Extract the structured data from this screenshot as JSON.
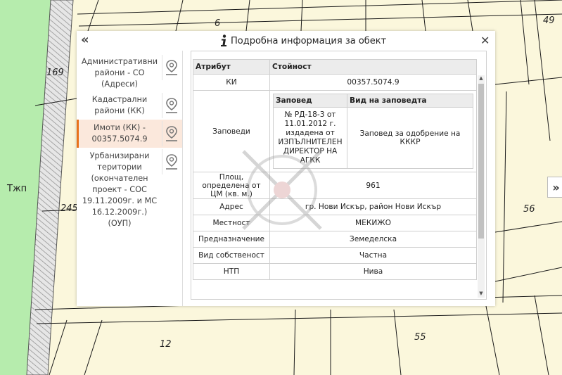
{
  "map": {
    "labels": [
      "6",
      "49",
      "169",
      "Тжп",
      "245",
      "56",
      "12",
      "55"
    ]
  },
  "panel": {
    "collapse_glyph": "«",
    "title": "Подробна информация за обект",
    "close_glyph": "✕",
    "expand_glyph": "»"
  },
  "sidebar": {
    "items": [
      {
        "label": "Административни райони - СО (Адреси)",
        "icon": "map-pin-icon"
      },
      {
        "label": "Кадастрални райони (КК)",
        "icon": "map-pin-icon"
      },
      {
        "label": "Имоти (КК) - 00357.5074.9",
        "icon": "map-pin-icon",
        "active": true
      },
      {
        "label": "Урбанизирани територии (окончателен проект - СОС 19.11.2009г. и МС 16.12.2009г.) (ОУП)",
        "icon": "map-pin-icon"
      }
    ]
  },
  "table": {
    "header_attr": "Атрибут",
    "header_value": "Стойност",
    "rows": [
      {
        "k": "КИ",
        "v": "00357.5074.9"
      },
      {
        "k": "Заповеди",
        "v": ""
      },
      {
        "k": "Площ, определена от ЦМ (кв. м.)",
        "v": "961"
      },
      {
        "k": "Адрес",
        "v": "гр. Нови Искър, район Нови Искър"
      },
      {
        "k": "Местност",
        "v": "МЕКИЖО"
      },
      {
        "k": "Предназначение",
        "v": "Земеделска"
      },
      {
        "k": "Вид собственост",
        "v": "Частна"
      },
      {
        "k": "НТП",
        "v": "Нива"
      }
    ],
    "orders": {
      "header_order": "Заповед",
      "header_type": "Вид на заповедта",
      "order": "№ РД-18-3 от 11.01.2012 г. издадена от ИЗПЪЛНИТЕЛЕН ДИРЕКТОР НА АГКК",
      "type": "Заповед за одобрение на КККР"
    }
  }
}
